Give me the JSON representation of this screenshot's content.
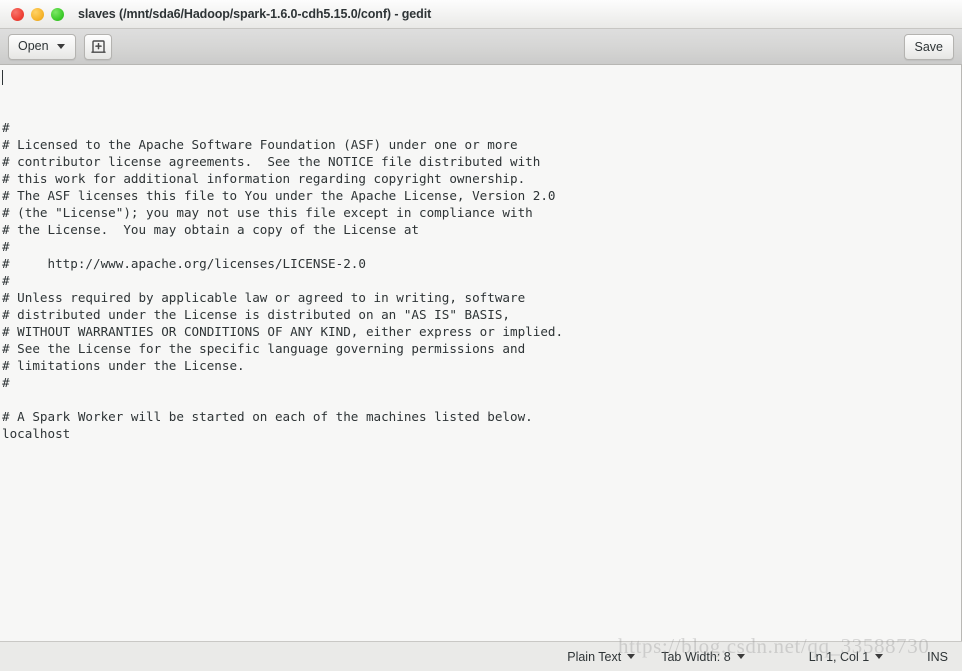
{
  "window": {
    "title": "slaves (/mnt/sda6/Hadoop/spark-1.6.0-cdh5.15.0/conf) - gedit",
    "app_name": "gedit",
    "controls": {
      "close": "",
      "minimize": "",
      "maximize": ""
    },
    "colors": {
      "close": "#ef4136",
      "minimize": "#f6b42c",
      "maximize": "#3fcc2c",
      "titlebar_bg": "#f2f2f1",
      "toolbar_bg": "#d6d6d5",
      "editor_bg": "#f7f7f6",
      "statusbar_bg": "#eaeae8",
      "text": "#2e3436"
    }
  },
  "toolbar": {
    "open_label": "Open",
    "new_document_tooltip": "Create a new document",
    "save_label": "Save"
  },
  "editor": {
    "file_name": "slaves",
    "lines": [
      "#",
      "# Licensed to the Apache Software Foundation (ASF) under one or more",
      "# contributor license agreements.  See the NOTICE file distributed with",
      "# this work for additional information regarding copyright ownership.",
      "# The ASF licenses this file to You under the Apache License, Version 2.0",
      "# (the \"License\"); you may not use this file except in compliance with",
      "# the License.  You may obtain a copy of the License at",
      "#",
      "#     http://www.apache.org/licenses/LICENSE-2.0",
      "#",
      "# Unless required by applicable law or agreed to in writing, software",
      "# distributed under the License is distributed on an \"AS IS\" BASIS,",
      "# WITHOUT WARRANTIES OR CONDITIONS OF ANY KIND, either express or implied.",
      "# See the License for the specific language governing permissions and",
      "# limitations under the License.",
      "#",
      "",
      "# A Spark Worker will be started on each of the machines listed below.",
      "localhost"
    ]
  },
  "statusbar": {
    "language": "Plain Text",
    "tab_width": "Tab Width: 8",
    "cursor_position": "Ln 1, Col 1",
    "insert_mode": "INS"
  },
  "watermark": {
    "text": "https://blog.csdn.net/qq_33588730"
  }
}
